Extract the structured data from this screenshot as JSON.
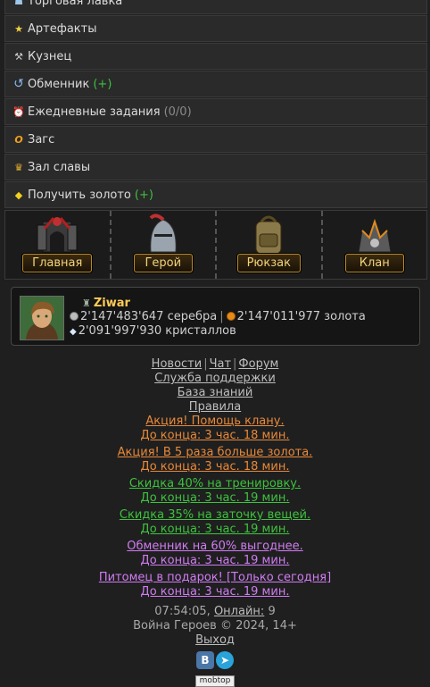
{
  "menu": {
    "items": [
      {
        "icon": "shop-icon",
        "glyph": "☗",
        "label": "Торговая лавка",
        "extra": "",
        "extra_color": ""
      },
      {
        "icon": "star-icon",
        "glyph": "★",
        "label": "Артефакты",
        "extra": "",
        "extra_color": ""
      },
      {
        "icon": "hammer-icon",
        "glyph": "⚒",
        "label": "Кузнец",
        "extra": "",
        "extra_color": ""
      },
      {
        "icon": "exchange-icon",
        "glyph": "↺",
        "label": "Обменник",
        "extra": "(+)",
        "extra_color": "green"
      },
      {
        "icon": "alarm-clock-icon",
        "glyph": "⏰",
        "label": "Ежедневные задания",
        "extra": "(0/0)",
        "extra_color": "grey"
      },
      {
        "icon": "ring-icon",
        "glyph": "O",
        "label": "Загс",
        "extra": "",
        "extra_color": ""
      },
      {
        "icon": "trophy-icon",
        "glyph": "♛",
        "label": "Зал славы",
        "extra": "",
        "extra_color": ""
      },
      {
        "icon": "gold-coins-icon",
        "glyph": "◆",
        "label": "Получить золото",
        "extra": "(+)",
        "extra_color": "green"
      }
    ]
  },
  "nav": {
    "main": "Главная",
    "hero": "Герой",
    "backpack": "Рюкзак",
    "clan": "Клан"
  },
  "profile": {
    "name": "Ziwar",
    "silver": "2'147'483'647 серебра",
    "gold": "2'147'011'977 золота",
    "crystals": "2'091'997'930 кристаллов"
  },
  "footer": {
    "news": "Новости",
    "chat": "Чат",
    "forum": "Форум",
    "support": "Служба поддержки",
    "knowledge": "База знаний",
    "rules": "Правила",
    "promos": [
      {
        "text": "Акция! Помощь клану.",
        "countdown": "До конца: 3 час. 18 мин.",
        "color": "orange"
      },
      {
        "text": "Акция! В 5 раза больше золота.",
        "countdown": "До конца: 3 час. 18 мин.",
        "color": "orange"
      },
      {
        "text": "Скидка 40% на тренировку.",
        "countdown": "До конца: 3 час. 19 мин.",
        "color": "green"
      },
      {
        "text": "Скидка 35% на заточку вещей.",
        "countdown": "До конца: 3 час. 19 мин.",
        "color": "green"
      },
      {
        "text": "Обменник на 60% выгоднее.",
        "countdown": "До конца: 3 час. 19 мин.",
        "color": "purple"
      },
      {
        "text": "Питомец в подарок! [Только сегодня]",
        "countdown": "До конца: 3 час. 19 мин.",
        "color": "purple"
      }
    ],
    "time": "07:54:05,",
    "online_label": "Онлайн:",
    "online_count": "9",
    "copyright": "Война Героев © 2024, 14+",
    "logout": "Выход",
    "vk": "В",
    "tg": "➤",
    "mobtop": "mobtop"
  }
}
